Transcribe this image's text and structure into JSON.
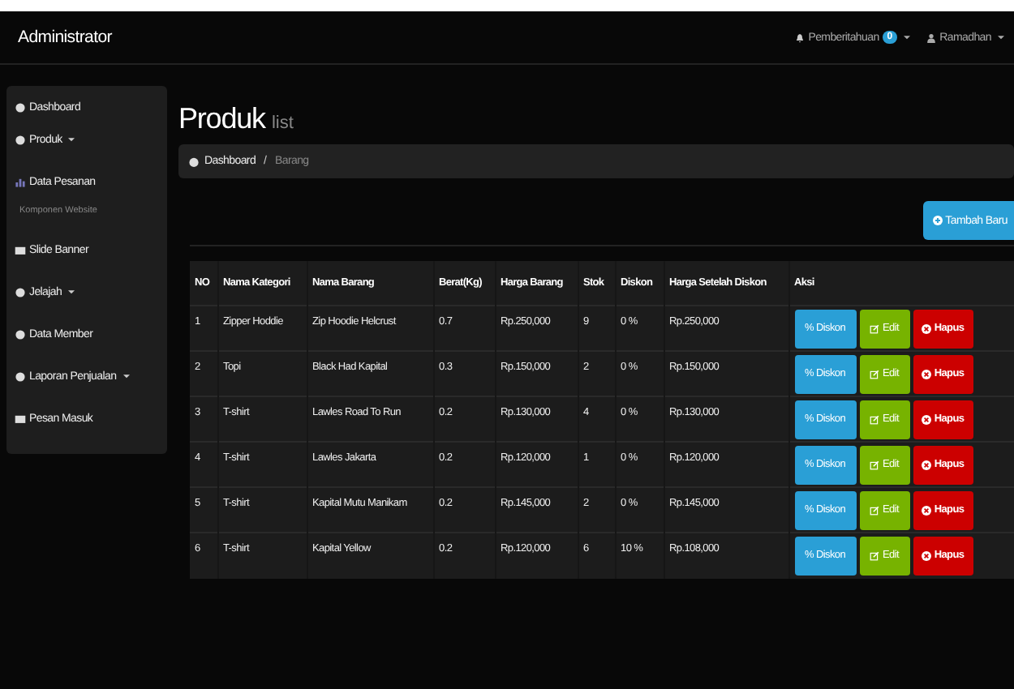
{
  "navbar": {
    "brand": "Administrator",
    "notifications": {
      "label": "Pemberitahuan",
      "count": "0"
    },
    "user": {
      "name": "Ramadhan"
    }
  },
  "sidebar": {
    "items": [
      {
        "kind": "link",
        "label": "Dashboard"
      },
      {
        "kind": "dropdown",
        "label": "Produk"
      },
      {
        "kind": "link",
        "label": "Data Pesanan"
      },
      {
        "kind": "header",
        "label": "Komponen Website"
      },
      {
        "kind": "link",
        "label": "Slide Banner"
      },
      {
        "kind": "dropdown",
        "label": "Jelajah"
      },
      {
        "kind": "link",
        "label": "Data Member"
      },
      {
        "kind": "dropdown",
        "label": "Laporan Penjualan"
      },
      {
        "kind": "link",
        "label": "Pesan Masuk"
      }
    ]
  },
  "page": {
    "title": "Produk",
    "subtitle": "list"
  },
  "breadcrumb": {
    "separator": "/",
    "items": [
      {
        "label": "Dashboard",
        "current": false
      },
      {
        "label": "Barang",
        "current": true
      }
    ]
  },
  "add_button": "Tambah Baru",
  "table": {
    "columns": [
      "NO",
      "Nama Kategori",
      "Nama Barang",
      "Berat(Kg)",
      "Harga Barang",
      "Stok",
      "Diskon",
      "Harga Setelah Diskon",
      "Aksi"
    ],
    "rows": [
      {
        "cells": [
          "1",
          "Zipper Hoddie",
          "Zip Hoodie Helcrust",
          "0.7",
          "Rp.250,000",
          "9",
          "0 %",
          "Rp.250,000"
        ],
        "actions": [
          "% Diskon",
          "Edit",
          "Hapus"
        ]
      },
      {
        "cells": [
          "2",
          "Topi",
          "Black Had Kapital",
          "0.3",
          "Rp.150,000",
          "2",
          "0 %",
          "Rp.150,000"
        ],
        "actions": [
          "% Diskon",
          "Edit",
          "Hapus"
        ]
      },
      {
        "cells": [
          "3",
          "T-shirt",
          "Lawles Road To Run",
          "0.2",
          "Rp.130,000",
          "4",
          "0 %",
          "Rp.130,000"
        ],
        "actions": [
          "% Diskon",
          "Edit",
          "Hapus"
        ]
      },
      {
        "cells": [
          "4",
          "T-shirt",
          "Lawles Jakarta",
          "0.2",
          "Rp.120,000",
          "1",
          "0 %",
          "Rp.120,000"
        ],
        "actions": [
          "% Diskon",
          "Edit",
          "Hapus"
        ]
      },
      {
        "cells": [
          "5",
          "T-shirt",
          "Kapital Mutu Manikam",
          "0.2",
          "Rp.145,000",
          "2",
          "0 %",
          "Rp.145,000"
        ],
        "actions": [
          "% Diskon",
          "Edit",
          "Hapus"
        ]
      },
      {
        "cells": [
          "6",
          "T-shirt",
          "Kapital Yellow",
          "0.2",
          "Rp.120,000",
          "6",
          "10 %",
          "Rp.108,000"
        ],
        "actions": [
          "% Diskon",
          "Edit",
          "Hapus"
        ]
      }
    ]
  }
}
